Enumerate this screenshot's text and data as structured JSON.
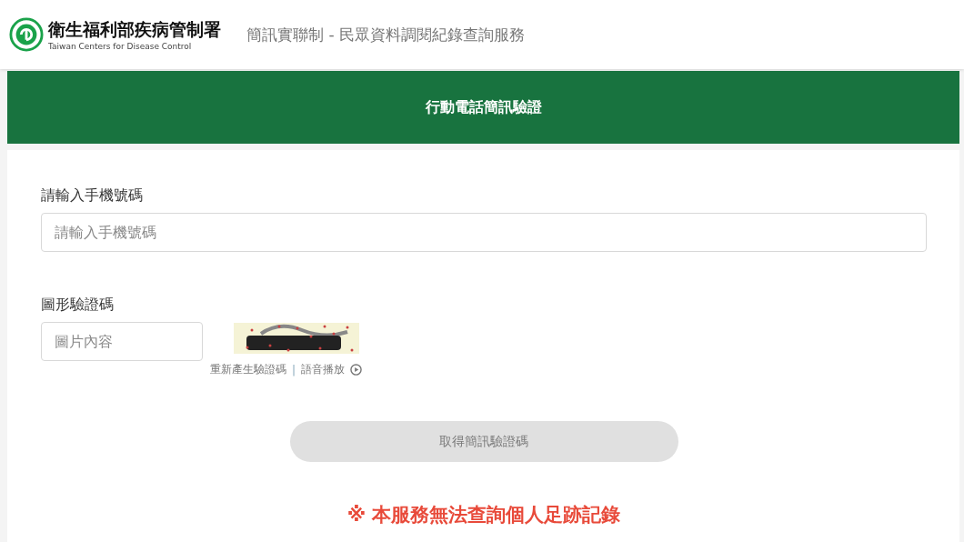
{
  "header": {
    "org_name": "衛生福利部疾病管制署",
    "org_name_en": "Taiwan Centers for Disease Control",
    "service_title": "簡訊實聯制 - 民眾資料調閱紀錄查詢服務"
  },
  "banner": {
    "title": "行動電話簡訊驗證"
  },
  "phone": {
    "label": "請輸入手機號碼",
    "placeholder": "請輸入手機號碼"
  },
  "captcha": {
    "label": "圖形驗證碼",
    "placeholder": "圖片內容",
    "regenerate_link": "重新產生驗證碼",
    "separator": "|",
    "audio_link": "語音播放"
  },
  "submit": {
    "label": "取得簡訊驗證碼",
    "disabled": true
  },
  "notice": "※ 本服務無法查詢個人足跡記錄"
}
